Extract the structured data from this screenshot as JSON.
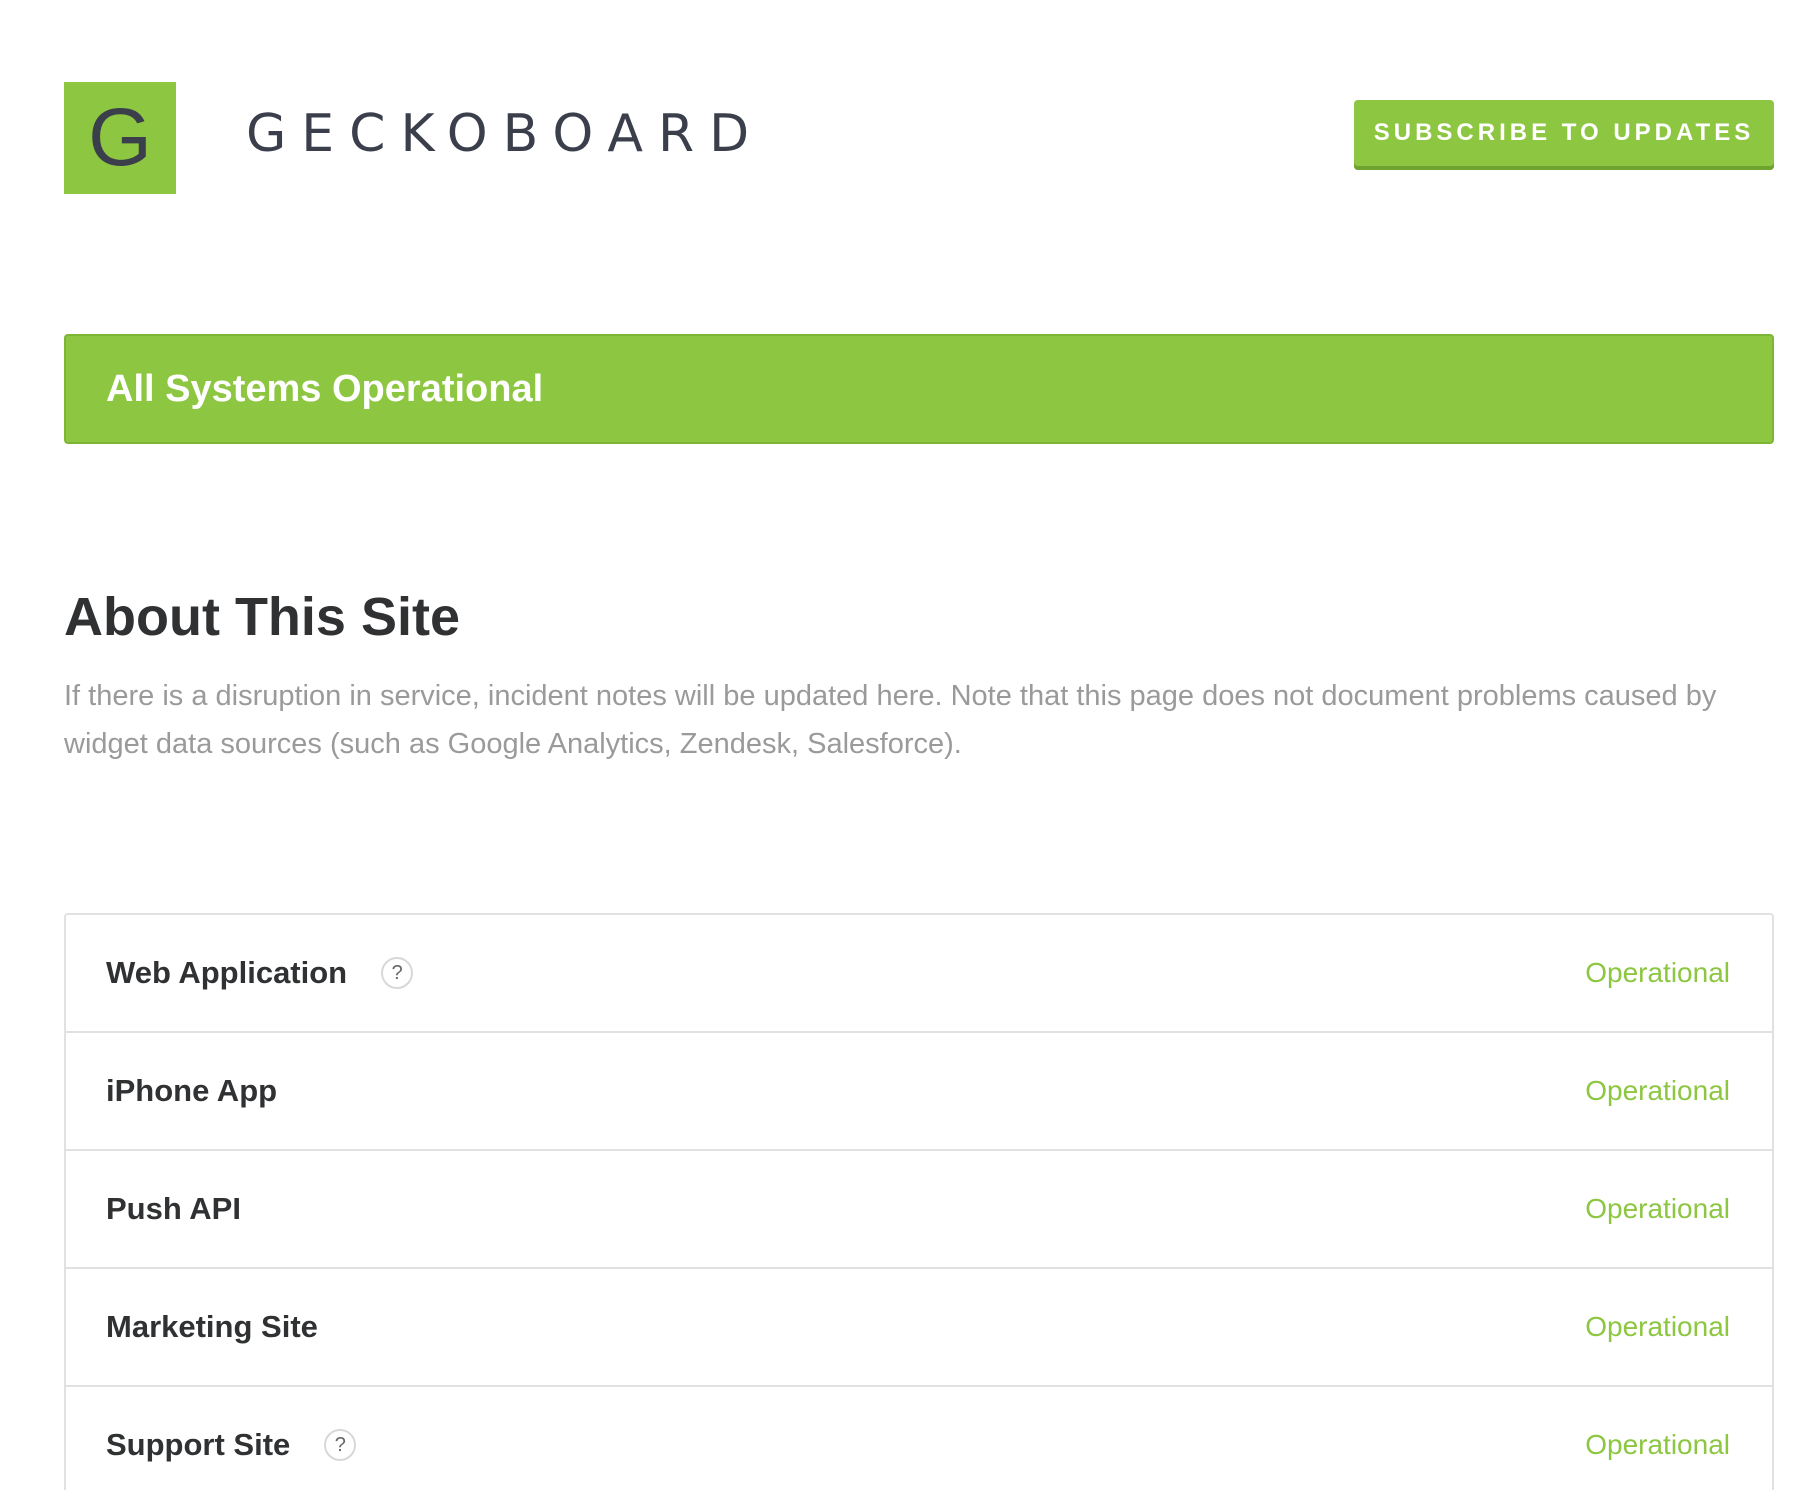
{
  "brand": {
    "logo_letter": "G",
    "name": "GECKOBOARD",
    "color": "#8dc641"
  },
  "header": {
    "subscribe_label": "SUBSCRIBE TO UPDATES"
  },
  "status_banner": {
    "text": "All Systems Operational"
  },
  "about": {
    "title": "About This Site",
    "description": "If there is a disruption in service, incident notes will be updated here. Note that this page does not document problems caused by widget data sources (such as Google Analytics, Zendesk, Salesforce)."
  },
  "components": [
    {
      "name": "Web Application",
      "status": "Operational",
      "has_help": true,
      "help_icon": "question-icon",
      "help_glyph": "?"
    },
    {
      "name": "iPhone App",
      "status": "Operational",
      "has_help": false
    },
    {
      "name": "Push API",
      "status": "Operational",
      "has_help": false
    },
    {
      "name": "Marketing Site",
      "status": "Operational",
      "has_help": false
    },
    {
      "name": "Support Site",
      "status": "Operational",
      "has_help": true,
      "help_icon": "question-icon",
      "help_glyph": "?"
    }
  ]
}
